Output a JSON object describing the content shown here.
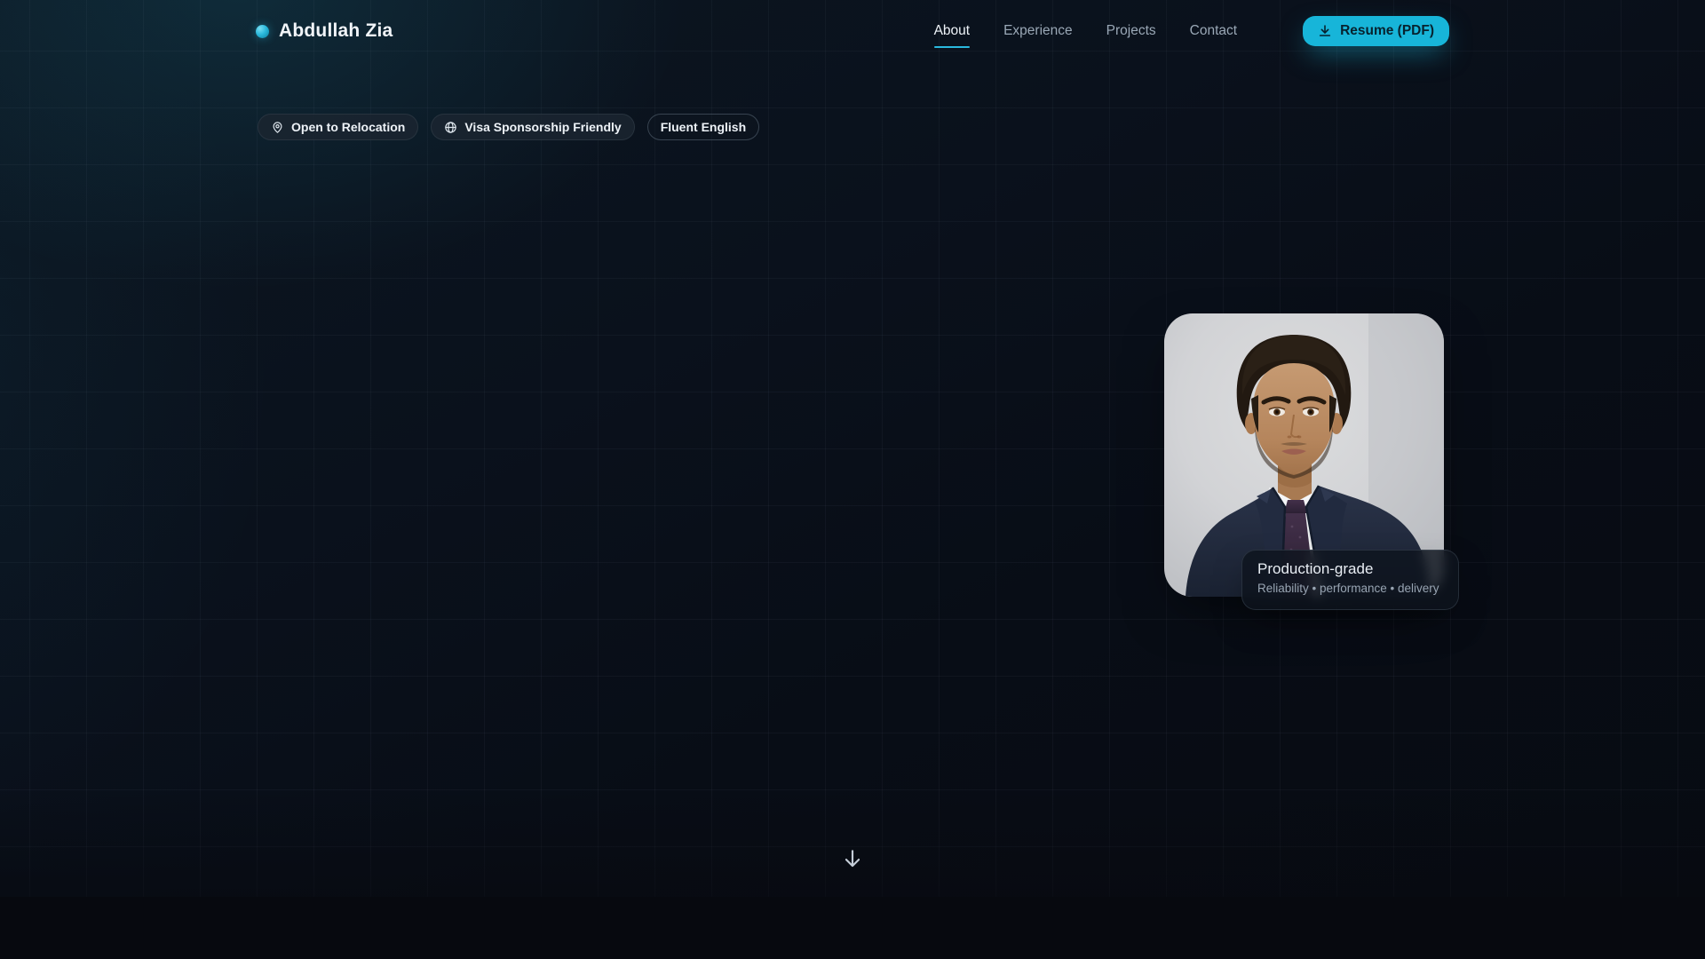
{
  "colors": {
    "accent": "#17b5d9",
    "background": "#080c14"
  },
  "header": {
    "brand": "Abdullah Zia",
    "nav": [
      {
        "label": "About",
        "active": true
      },
      {
        "label": "Experience",
        "active": false
      },
      {
        "label": "Projects",
        "active": false
      },
      {
        "label": "Contact",
        "active": false
      }
    ],
    "resume_button_label": "Resume (PDF)"
  },
  "hero": {
    "badges": [
      {
        "icon": "pin-icon",
        "label": "Open to Relocation"
      },
      {
        "icon": "globe-icon",
        "label": "Visa Sponsorship Friendly"
      },
      {
        "icon": "",
        "label": "Fluent English"
      }
    ],
    "photo": {
      "description": "Portrait of a man in a navy suit on a light gray studio background"
    },
    "photo_caption": {
      "title": "Production-grade",
      "subtitle": "Reliability • performance • delivery"
    }
  }
}
